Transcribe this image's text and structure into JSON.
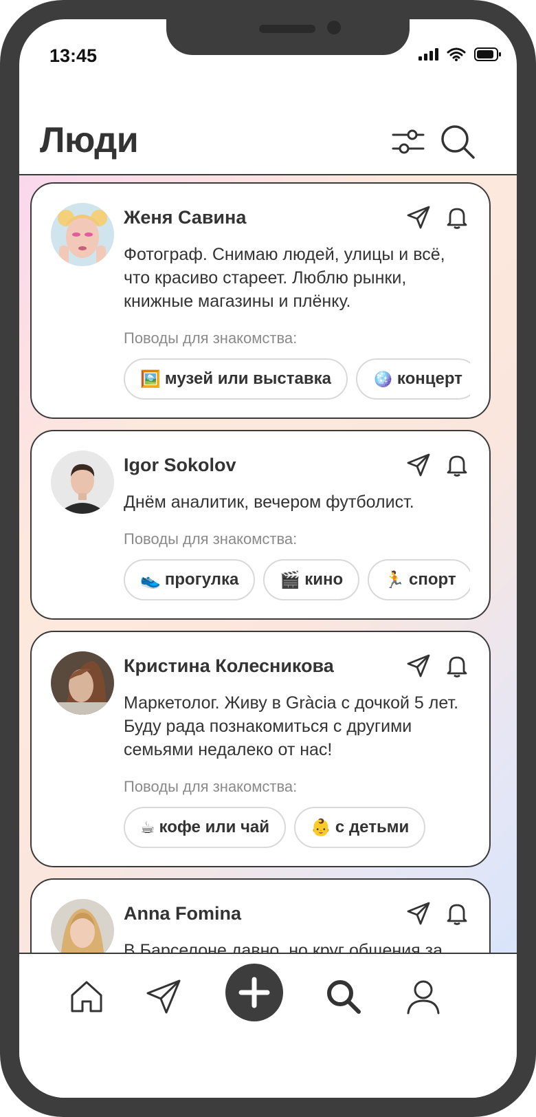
{
  "status_bar": {
    "time": "13:45",
    "icons": [
      "signal-icon",
      "wifi-icon",
      "battery-icon"
    ]
  },
  "header": {
    "title": "Люди",
    "actions": [
      "filter-icon",
      "search-icon"
    ]
  },
  "cards": [
    {
      "name": "Женя Савина",
      "bio": "Фотограф. Снимаю людей, улицы и всё, что красиво стареет. Люблю рынки, книжные магазины и плёнку.",
      "reasons_label": "Поводы для знакомства:",
      "chips": [
        {
          "emoji": "🖼️",
          "label": "музей или выставка"
        },
        {
          "emoji": "🪩",
          "label": "концерт"
        }
      ]
    },
    {
      "name": "Igor Sokolov",
      "bio": "Днём аналитик, вечером футболист.",
      "reasons_label": "Поводы для знакомства:",
      "chips": [
        {
          "emoji": "👟",
          "label": "прогулка"
        },
        {
          "emoji": "🎬",
          "label": "кино"
        },
        {
          "emoji": "🏃",
          "label": "спорт"
        }
      ]
    },
    {
      "name": "Кристина Колесникова",
      "bio": "Маркетолог. Живу в Gràcia с дочкой 5 лет. Буду рада познакомиться с другими семьями недалеко от нас!",
      "reasons_label": "Поводы для знакомства:",
      "chips": [
        {
          "emoji": "☕",
          "label": "кофе или чай"
        },
        {
          "emoji": "👶",
          "label": "с детьми"
        }
      ]
    },
    {
      "name": "Anna Fomina",
      "bio": "В Барселоне давно, но круг общения за последние годы сильно поредел."
    }
  ],
  "tab_bar": {
    "items": [
      "home-icon",
      "send-icon",
      "add-icon",
      "search-icon",
      "profile-icon"
    ]
  },
  "colors": {
    "frame": "#3d3d3d",
    "text": "#333333",
    "muted": "#8a8a8a",
    "chip_border": "#d9d9d9"
  }
}
